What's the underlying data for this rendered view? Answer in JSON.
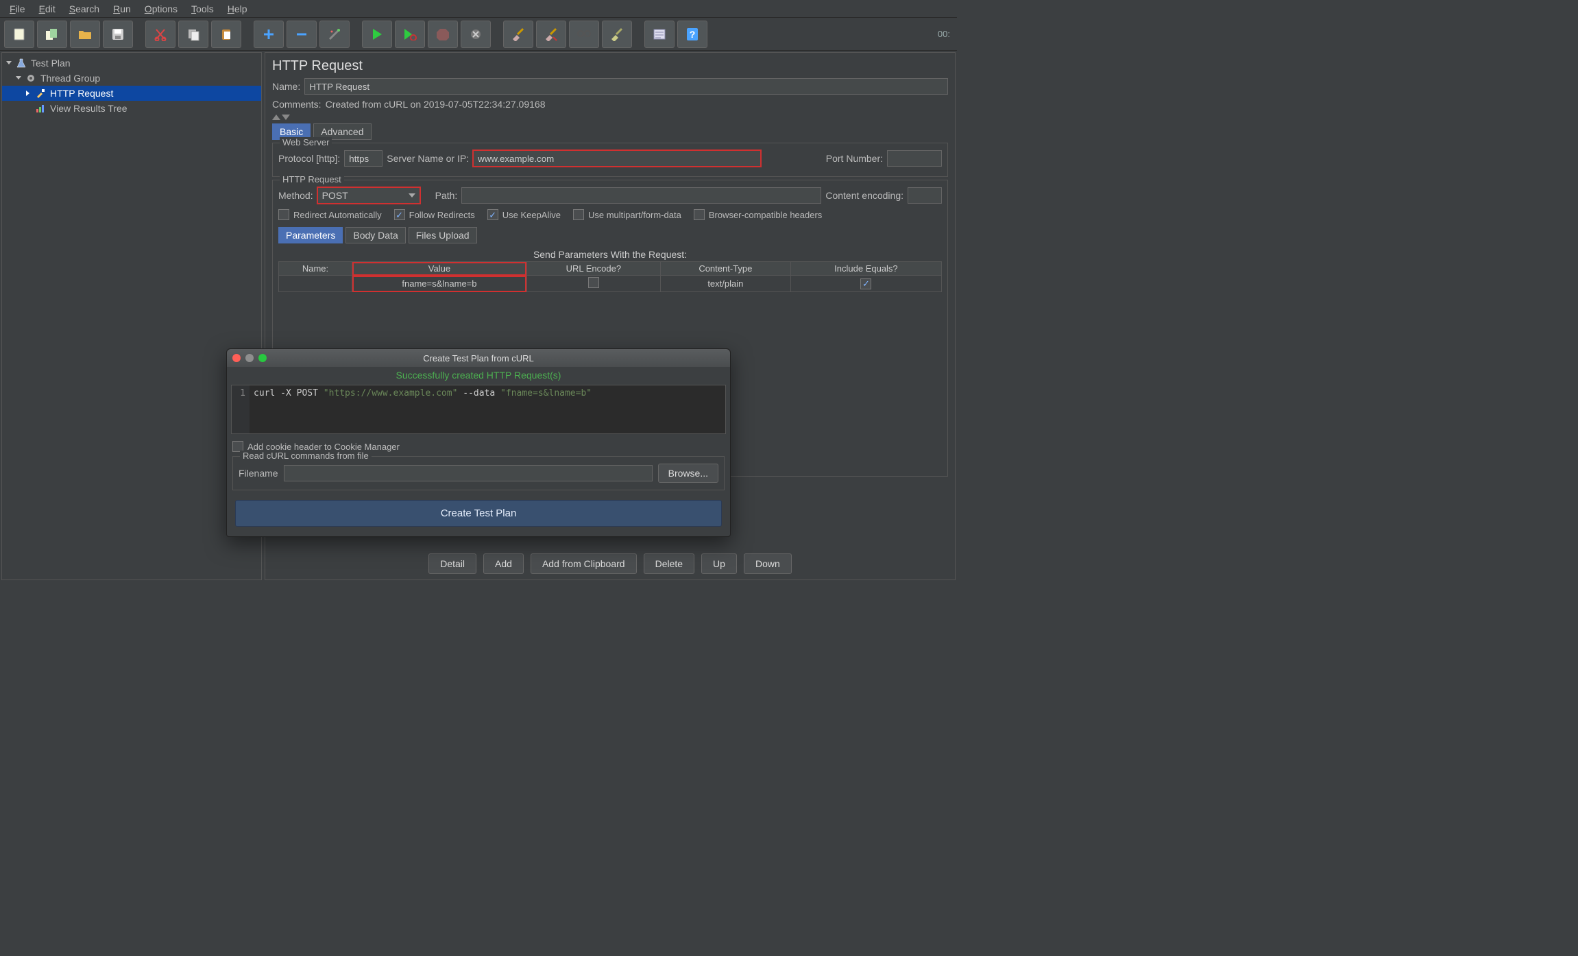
{
  "menubar": [
    "File",
    "Edit",
    "Search",
    "Run",
    "Options",
    "Tools",
    "Help"
  ],
  "toolbar": {
    "timer": "00:"
  },
  "tree": {
    "root": "Test Plan",
    "group": "Thread Group",
    "http": "HTTP Request",
    "results": "View Results Tree"
  },
  "editor": {
    "title": "HTTP Request",
    "name_label": "Name:",
    "name_value": "HTTP Request",
    "comments_label": "Comments:",
    "comments_value": "Created from cURL on 2019-07-05T22:34:27.09168",
    "tabs": {
      "basic": "Basic",
      "advanced": "Advanced"
    },
    "webserver": {
      "legend": "Web Server",
      "protocol_label": "Protocol [http]:",
      "protocol_value": "https",
      "server_label": "Server Name or IP:",
      "server_value": "www.example.com",
      "port_label": "Port Number:",
      "port_value": ""
    },
    "httpreq": {
      "legend": "HTTP Request",
      "method_label": "Method:",
      "method_value": "POST",
      "path_label": "Path:",
      "path_value": "",
      "encoding_label": "Content encoding:",
      "encoding_value": ""
    },
    "flags": {
      "redirect_auto": "Redirect Automatically",
      "follow_redirects": "Follow Redirects",
      "keepalive": "Use KeepAlive",
      "multipart": "Use multipart/form-data",
      "browser_headers": "Browser-compatible headers"
    },
    "param_tabs": {
      "params": "Parameters",
      "body": "Body Data",
      "files": "Files Upload"
    },
    "params_title": "Send Parameters With the Request:",
    "table": {
      "headers": [
        "Name:",
        "Value",
        "URL Encode?",
        "Content-Type",
        "Include Equals?"
      ],
      "row": {
        "name": "",
        "value": "fname=s&lname=b",
        "url_encode": false,
        "content_type": "text/plain",
        "include_equals": true
      }
    },
    "buttons": {
      "detail": "Detail",
      "add": "Add",
      "clipboard": "Add from Clipboard",
      "delete": "Delete",
      "up": "Up",
      "down": "Down"
    }
  },
  "dialog": {
    "title": "Create Test Plan from cURL",
    "success": "Successfully created HTTP Request(s)",
    "line_no": "1",
    "code_plain1": "curl -X POST ",
    "code_url": "\"https://www.example.com\"",
    "code_plain2": " --data ",
    "code_data": "\"fname=s&lname=b\"",
    "cookie_label": "Add cookie header to Cookie Manager",
    "read_legend": "Read cURL commands from file",
    "filename_label": "Filename",
    "filename_value": "",
    "browse": "Browse...",
    "create": "Create Test Plan"
  }
}
